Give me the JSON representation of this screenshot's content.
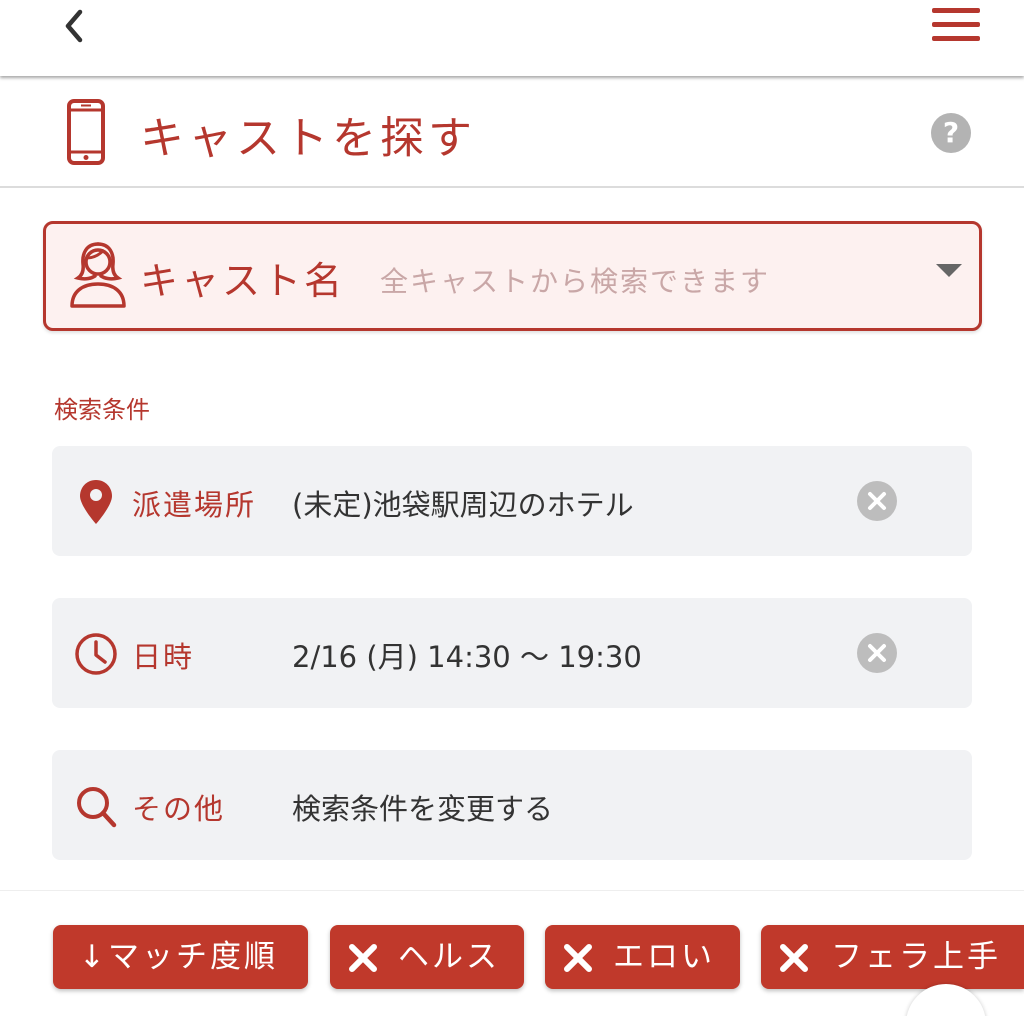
{
  "header": {
    "back_icon": "chevron-left-icon",
    "menu_icon": "hamburger-menu-icon"
  },
  "title": {
    "text": "キャストを探す",
    "icon": "smartphone-icon",
    "help": "?"
  },
  "cast_select": {
    "label": "キャスト名",
    "placeholder": "全キャストから検索できます",
    "icon": "woman-user-icon"
  },
  "search": {
    "section_label": "検索条件",
    "location": {
      "label": "派遣場所",
      "value": "(未定)池袋駅周辺のホテル",
      "icon": "map-pin-icon"
    },
    "datetime": {
      "label": "日時",
      "value": "2/16 (月) 14:30 〜 19:30",
      "icon": "clock-icon"
    },
    "other": {
      "label": "その他",
      "value": "検索条件を変更する",
      "icon": "search-icon"
    }
  },
  "chips": [
    {
      "label": "↓マッチ度順"
    },
    {
      "label": "ヘルス"
    },
    {
      "label": "エロい"
    },
    {
      "label": "フェラ上手"
    }
  ],
  "colors": {
    "accent": "#b5372e",
    "chip": "#c0392b",
    "card": "#f1f2f4",
    "select_bg": "#fdf1f0"
  }
}
